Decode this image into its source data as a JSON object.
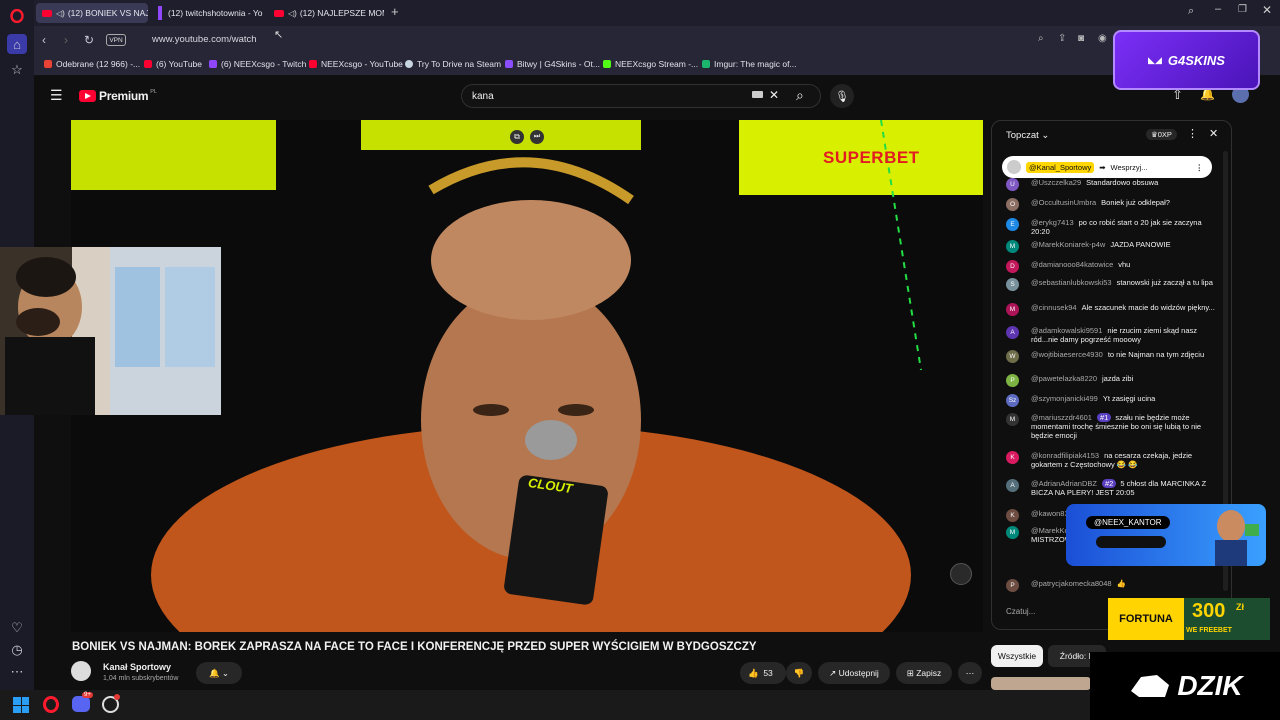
{
  "tabs": [
    {
      "label": "(12) BONIEK VS NAJM",
      "active": true
    },
    {
      "label": "(12) twitchshotownia - Yo",
      "active": false
    },
    {
      "label": "(12) NAJLEPSZE MOM",
      "active": false
    }
  ],
  "address": {
    "vpn": "VPN",
    "url": "www.youtube.com/watch"
  },
  "bookmarks": [
    {
      "label": "Odebrane (12 966) -...",
      "icon": "gmail-icon",
      "color": "#ea4335"
    },
    {
      "label": "(6) YouTube",
      "icon": "youtube-icon",
      "color": "#ff0033"
    },
    {
      "label": "(6) NEEXcsgo - Twitch",
      "icon": "twitch-icon",
      "color": "#9146ff"
    },
    {
      "label": "NEEXcsgo - YouTube",
      "icon": "youtube-icon",
      "color": "#ff0033"
    },
    {
      "label": "Try To Drive na Steam",
      "icon": "steam-icon",
      "color": "#c7d5e0"
    },
    {
      "label": "Bitwy | G4Skins - Ot...",
      "icon": "g4skins-icon",
      "color": "#8a4dff"
    },
    {
      "label": "NEEXcsgo Stream -...",
      "icon": "kick-icon",
      "color": "#53fc18"
    },
    {
      "label": "Imgur: The magic of...",
      "icon": "imgur-icon",
      "color": "#1bb76e"
    }
  ],
  "youtube": {
    "logo": "Premium",
    "region": "PL",
    "search_value": "kana",
    "notifications": "9+"
  },
  "video": {
    "brand_text": "SUPERBET",
    "mic_text": "CLOUT",
    "title": "BONIEK VS NAJMAN: BOREK ZAPRASZA NA FACE TO FACE I KONFERENCJĘ PRZED SUPER WYŚCIGIEM W BYDGOSZCZY",
    "channel": "Kanał Sportowy",
    "subscribers": "1,04 mln subskrybentów",
    "likes": "53",
    "share": "Udostępnij",
    "save": "Zapisz"
  },
  "chat": {
    "mode": "Topczat",
    "points": "0XP",
    "pinned_author": "@Kanal_Sportowy",
    "pinned_text": "Wesprzyj...",
    "input_placeholder": "Czatuj...",
    "messages": [
      {
        "author": "@Uszczelka29",
        "text": "Standardowo obsuwa",
        "avatar": "U",
        "color": "#7e57c2"
      },
      {
        "author": "@OccultusinUmbra",
        "text": "Boniek już odklepał?",
        "avatar": "O",
        "color": "#8d6e63"
      },
      {
        "author": "@erykg7413",
        "text": "po co robić start o 20 jak sie zaczyna 20:20",
        "avatar": "E",
        "color": "#1e88e5"
      },
      {
        "author": "@MarekKoniarek-p4w",
        "text": "JAZDA PANOWIE",
        "avatar": "M",
        "color": "#00897b"
      },
      {
        "author": "@damianooo84katowice",
        "text": "vhu",
        "avatar": "D",
        "color": "#c2185b"
      },
      {
        "author": "@sebastianlubkowski53",
        "text": "stanowski już zaczął a tu lipa",
        "avatar": "S",
        "color": "#78909c"
      },
      {
        "author": "@cinnusek94",
        "text": "Ale szacunek macie do widzów piękny...",
        "avatar": "M",
        "color": "#ad1457"
      },
      {
        "author": "@adamkowalski9591",
        "text": "nie rzucim ziemi skąd nasz ród...nie damy pogrześć mooowy",
        "avatar": "A",
        "color": "#5e35b1"
      },
      {
        "author": "@wojtibiaeserce4930",
        "text": "to nie Najman na tym zdjęciu",
        "avatar": "W",
        "color": "#6d6d4a"
      },
      {
        "author": "@pawetelazka8220",
        "text": "jazda zibi",
        "avatar": "P",
        "color": "#7cb342"
      },
      {
        "author": "@szymonjanicki499",
        "text": "Yt zasięgi ucina",
        "avatar": "Sz",
        "color": "#5c6bc0"
      },
      {
        "author": "@mariuszzdr4601",
        "badge": "#1",
        "text": "szału nie będzie może momentami trochę śmiesznie bo oni się lubią to nie będzie emocji",
        "avatar": "M",
        "color": "#333333"
      },
      {
        "author": "@konradfilipiak4153",
        "text": "na cesarza czekaja, jedzie gokartem z Częstochowy 😂 😂",
        "avatar": "K",
        "color": "#d81b60"
      },
      {
        "author": "@AdrianAdrianDBZ",
        "badge": "#2",
        "text": "5 chłost dla MARCINKA Z BICZA NA PLERY! JEST 20:05",
        "avatar": "A",
        "color": "#546e7a"
      },
      {
        "author": "@kawon83",
        "text": "",
        "avatar": "K",
        "color": "#6d4c41"
      },
      {
        "author": "@MarekKo",
        "text": "CHŁOPAKI RYWALIZA ECHEM W MISTRZOWSKI PAS W K OT",
        "avatar": "M",
        "color": "#00897b"
      },
      {
        "author": "@patrycjakomecka8048",
        "text": "👍",
        "avatar": "P",
        "color": "#6d4c41"
      }
    ]
  },
  "filters": [
    "Wszystkie",
    "Źródło: K"
  ],
  "overlays": {
    "g4skins": "G4SKINS",
    "neex": "@NEEX_KANTOR",
    "fortuna": "FORTUNA",
    "fortuna_amount": "300",
    "fortuna_currency": "Zł",
    "fortuna_sub": "WE FREEBET",
    "dzik": "DZIK"
  },
  "taskbar": {
    "discord_badge": "9+"
  }
}
